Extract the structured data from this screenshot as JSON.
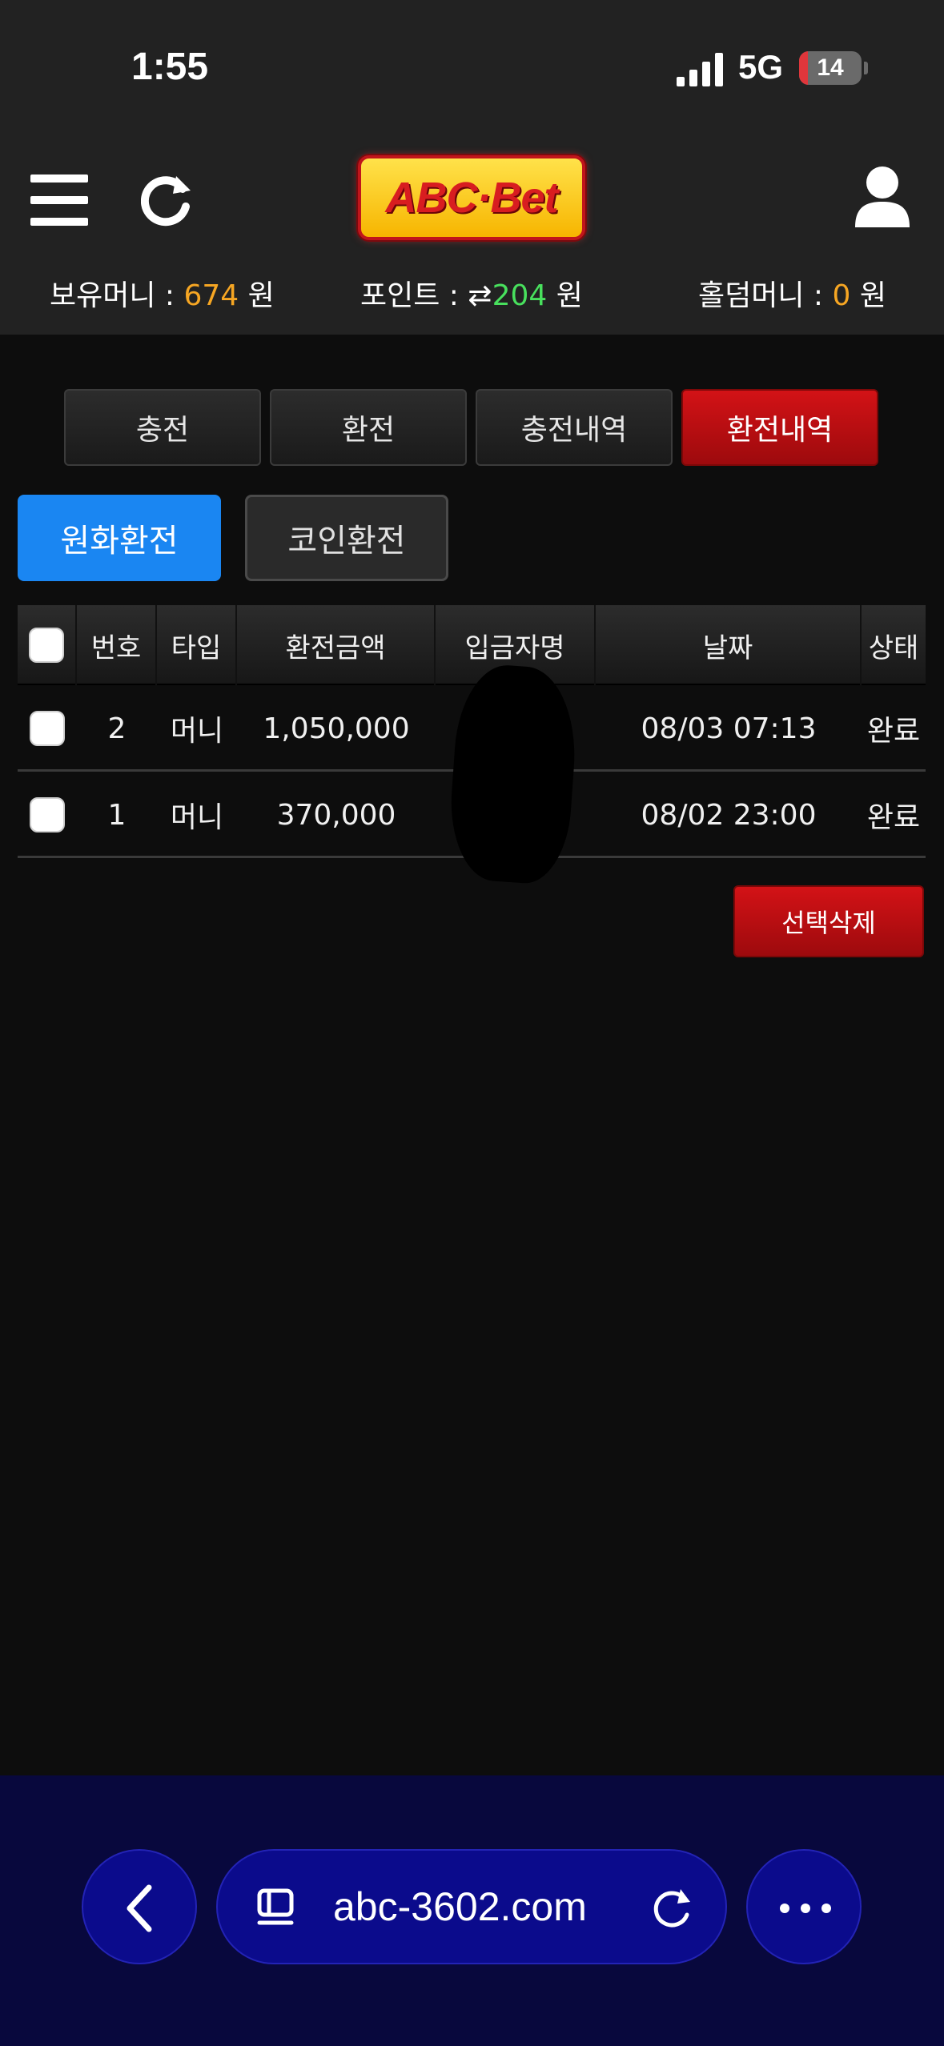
{
  "status_bar": {
    "time": "1:55",
    "network": "5G",
    "battery": "14",
    "battery_level": 0.14
  },
  "header": {
    "logo_text": "ABC·Bet",
    "icons": [
      "menu-icon",
      "refresh-icon",
      "user-icon"
    ]
  },
  "balance": {
    "money_label": "보유머니 : ",
    "money_value": "674",
    "money_unit": " 원",
    "point_label": "포인트 : ",
    "point_value": "204",
    "point_unit": " 원",
    "hold_label": "홀덤머니 : ",
    "hold_value": "0",
    "hold_unit": " 원"
  },
  "tabs": [
    {
      "label": "충전",
      "active": false
    },
    {
      "label": "환전",
      "active": false
    },
    {
      "label": "충전내역",
      "active": false
    },
    {
      "label": "환전내역",
      "active": true
    }
  ],
  "subtabs": {
    "won": "원화환전",
    "coin": "코인환전"
  },
  "table": {
    "headers": [
      "번호",
      "타입",
      "환전금액",
      "입금자명",
      "날짜",
      "상태"
    ],
    "rows": [
      {
        "num": "2",
        "type": "머니",
        "amount": "1,050,000",
        "depositor": "",
        "date": "08/03 07:13",
        "status": "완료"
      },
      {
        "num": "1",
        "type": "머니",
        "amount": "370,000",
        "depositor": "",
        "date": "08/02 23:00",
        "status": "완료"
      }
    ]
  },
  "delete_button": "선택삭제",
  "browser": {
    "url": "abc-3602.com"
  },
  "colors": {
    "accent_red": "#c40f13",
    "accent_blue": "#1a86f2",
    "money_orange": "#f6a623",
    "point_green": "#48e05d",
    "browser_bg": "#08083d"
  }
}
